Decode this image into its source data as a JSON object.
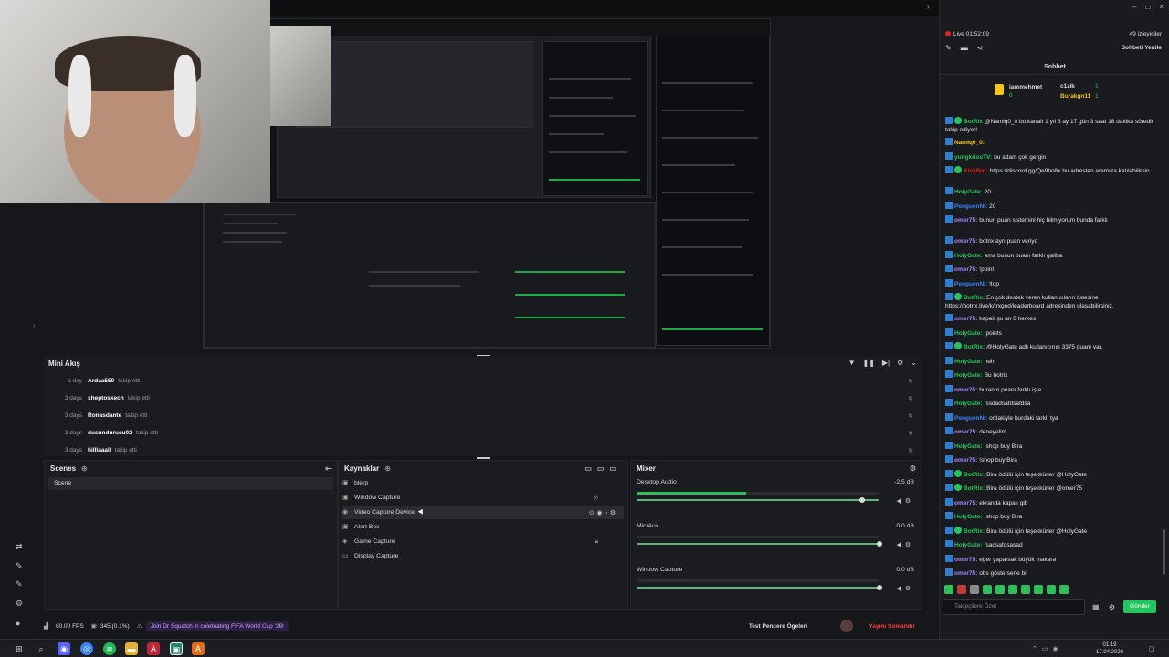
{
  "app": {
    "window_controls": [
      "–",
      "□",
      "×"
    ]
  },
  "chat_window_controls": [
    "–",
    "□",
    "×"
  ],
  "mini_feed": {
    "title": "Mini Akış",
    "rows": [
      {
        "time": "a day",
        "name": "Ardaa550",
        "action": "takip etti"
      },
      {
        "time": "3 days",
        "name": "sheptoskech",
        "action": "takip etti"
      },
      {
        "time": "3 days",
        "name": "Ronasdante",
        "action": "takip etti"
      },
      {
        "time": "3 days",
        "name": "dusundurucu02",
        "action": "takip etti"
      },
      {
        "time": "3 days",
        "name": "hilllaaall",
        "action": "takip etti"
      }
    ]
  },
  "scenes": {
    "title": "Scenes",
    "items": [
      "Scene"
    ]
  },
  "sources": {
    "title": "Kaynaklar",
    "items": [
      "blerp",
      "Window Capture",
      "Video Capture Device",
      "Alert Box",
      "Game Capture",
      "Display Capture"
    ]
  },
  "mixer": {
    "title": "Mixer",
    "channels": [
      {
        "name": "Desktop Audio",
        "db": "-2.5 dB",
        "level": 0.45,
        "volume": 0.93
      },
      {
        "name": "Mic/Aux",
        "db": "0.0 dB",
        "level": 0,
        "volume": 1.0
      },
      {
        "name": "Window Capture",
        "db": "0.0 dB",
        "level": 0,
        "volume": 1.0
      }
    ]
  },
  "status": {
    "fps": "60.00 FPS",
    "dropped": "345 (0.1%)",
    "banner": "Join Dr Squatch in celebrating FIFA World Cup '26!",
    "test_label": "Test Pencere Ögeleri",
    "end_stream": "Yayını Sonlandır"
  },
  "chat": {
    "live": "Live 01:52:09",
    "viewers": "49 izleyiciler",
    "refresh": "Sohbeti Yenile",
    "tab": "Sohbet",
    "leaderboard": {
      "left_name": "iammehmet",
      "left_count": "6",
      "right": [
        {
          "name": "c1zik",
          "count": "1"
        },
        {
          "name": "Burakgn11",
          "count": "1"
        }
      ]
    },
    "input_placeholder": "Takipçilere Özel",
    "send": "Gönder",
    "messages": [
      {
        "user": "BotRix",
        "color": "#22c55e",
        "bot": true,
        "text": "@Namiq0_0 bu kanalı 1 yıl 3 ay 17 gün 3 saat 18 dakika süredir takip ediyor!"
      },
      {
        "user": "Namiq0_0:",
        "color": "#f5c518",
        "bot": false,
        "text": ""
      },
      {
        "user": "yungkriosTV:",
        "color": "#22c55e",
        "bot": false,
        "text": "bu adam çok gergin"
      },
      {
        "user": "KickBot:",
        "color": "#e02424",
        "bot": true,
        "text": "https://discord.gg/Qe9ho8x bu adresten aramıza katılabilirsin."
      },
      {
        "user": "HolyGate:",
        "color": "#22c55e",
        "bot": false,
        "text": "20"
      },
      {
        "user": "PenguenNi:",
        "color": "#3b82f6",
        "bot": false,
        "text": "20"
      },
      {
        "user": "omer75:",
        "color": "#a78bfa",
        "bot": false,
        "text": "bunun puan sistemini hiç bilmiyorum bunda farklı"
      },
      {
        "user": "omer75:",
        "color": "#a78bfa",
        "bot": false,
        "text": "botrix ayrı puan veriyo"
      },
      {
        "user": "HolyGate:",
        "color": "#22c55e",
        "bot": false,
        "text": "ama bunun puanı farklı galiba"
      },
      {
        "user": "omer75:",
        "color": "#a78bfa",
        "bot": false,
        "text": "!point"
      },
      {
        "user": "PenguenNi:",
        "color": "#3b82f6",
        "bot": false,
        "text": "!top"
      },
      {
        "user": "BotRix:",
        "color": "#22c55e",
        "bot": true,
        "text": "En çok destek veren kullanıcıların listesine https://botrix.live/k/trxgod/leaderboard adresinden ulaşabilirsiniz."
      },
      {
        "user": "omer75:",
        "color": "#a78bfa",
        "bot": false,
        "text": "kapalı şu an 0 herkes"
      },
      {
        "user": "HolyGate:",
        "color": "#22c55e",
        "bot": false,
        "text": "!points"
      },
      {
        "user": "BotRix:",
        "color": "#22c55e",
        "bot": true,
        "text": "@HolyGate adlı kullanıcının 3375 puanı var."
      },
      {
        "user": "HolyGate:",
        "color": "#22c55e",
        "bot": false,
        "text": "heh"
      },
      {
        "user": "HolyGate:",
        "color": "#22c55e",
        "bot": false,
        "text": "Bu botrix"
      },
      {
        "user": "omer75:",
        "color": "#a78bfa",
        "bot": false,
        "text": "buranın puanı farklı işte"
      },
      {
        "user": "HolyGate:",
        "color": "#22c55e",
        "bot": false,
        "text": "fssdadsafdsafdsa"
      },
      {
        "user": "PenguenNi:",
        "color": "#3b82f6",
        "bot": false,
        "text": "ordakiyle burdaki farklı tya"
      },
      {
        "user": "omer75:",
        "color": "#a78bfa",
        "bot": false,
        "text": "deneyelim"
      },
      {
        "user": "HolyGate:",
        "color": "#22c55e",
        "bot": false,
        "text": "!shop buy Bira"
      },
      {
        "user": "omer75:",
        "color": "#a78bfa",
        "bot": false,
        "text": "!shop buy Bira"
      },
      {
        "user": "BotRix:",
        "color": "#22c55e",
        "bot": true,
        "text": "Bira ödülü için teşekkürler @HolyGate"
      },
      {
        "user": "BotRix:",
        "color": "#22c55e",
        "bot": true,
        "text": "Bira ödülü için teşekkürler @omer75"
      },
      {
        "user": "omer75:",
        "color": "#a78bfa",
        "bot": false,
        "text": "ekranda kapalı gib"
      },
      {
        "user": "HolyGate:",
        "color": "#22c55e",
        "bot": false,
        "text": "!shop buy Bira"
      },
      {
        "user": "BotRix:",
        "color": "#22c55e",
        "bot": true,
        "text": "Bira ödülü için teşekkürler @HolyGate"
      },
      {
        "user": "HolyGate:",
        "color": "#22c55e",
        "bot": false,
        "text": "fsadsafdsasad"
      },
      {
        "user": "omer75:",
        "color": "#a78bfa",
        "bot": false,
        "text": "eğer yaparsak büyük makara"
      },
      {
        "user": "omer75:",
        "color": "#a78bfa",
        "bot": false,
        "text": "obs göstersene bi"
      }
    ]
  },
  "taskbar": {
    "time": "01:19",
    "date": "17.04.2026"
  },
  "colors": {
    "accent_green": "#22c55e",
    "end_stream_red": "#ff3b3b",
    "banner_purple": "#8b5cf6"
  }
}
